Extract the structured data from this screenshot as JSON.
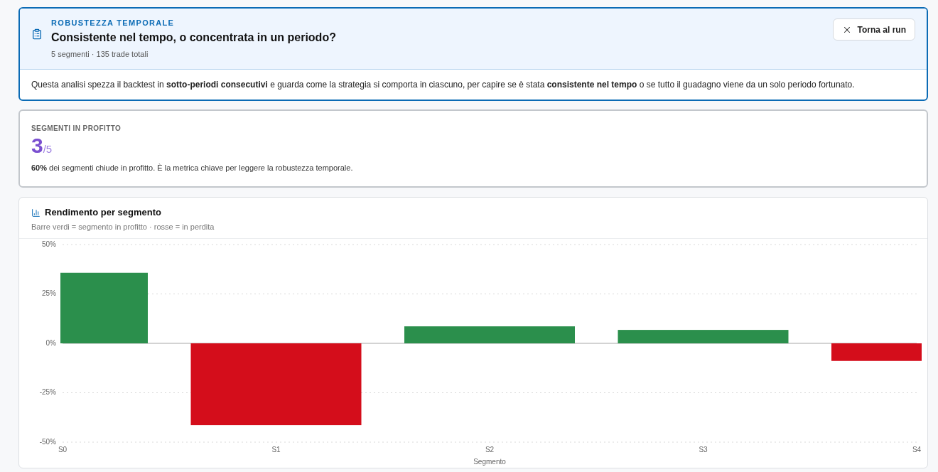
{
  "header": {
    "eyebrow": "ROBUSTEZZA TEMPORALE",
    "title": "Consistente nel tempo, o concentrata in un periodo?",
    "meta": "5 segmenti · 135 trade totali",
    "close_button": "Torna al run"
  },
  "intro": "Questa analisi spezza il backtest in **sotto-periodi consecutivi** e guarda come la strategia si comporta in ciascuno, per capire se è stata **consistente nel tempo** o se tutto il guadagno viene da un solo periodo fortunato.",
  "metric": {
    "label": "SEGMENTI IN PROFITTO",
    "value": "3",
    "total": "/5",
    "note": "**60%** dei segmenti chiude in profitto. È la metrica chiave per leggere la robustezza temporale."
  },
  "chart_card": {
    "title": "Rendimento per segmento",
    "subtitle": "Barre verdi = segmento in profitto · rosse = in perdita",
    "chart_data": {
      "type": "bar",
      "xlabel": "Segmento",
      "categories": [
        "S0",
        "S1",
        "S2",
        "S3",
        "S4"
      ],
      "series": [
        {
          "color": "#2b8f4c",
          "values": [
            35.7,
            null,
            8.6,
            6.8,
            null
          ]
        },
        {
          "color": "#d40d1b",
          "values": [
            null,
            -41.4,
            null,
            null,
            -8.9
          ]
        }
      ],
      "stacked": true,
      "ylim": [
        -50,
        50
      ],
      "yticks": [
        {
          "value": 50,
          "label": "50%"
        },
        {
          "value": 25,
          "label": "25%"
        },
        {
          "value": 0,
          "label": "0%"
        },
        {
          "value": -25,
          "label": "-25%"
        },
        {
          "value": -50,
          "label": "-50%"
        }
      ]
    }
  }
}
